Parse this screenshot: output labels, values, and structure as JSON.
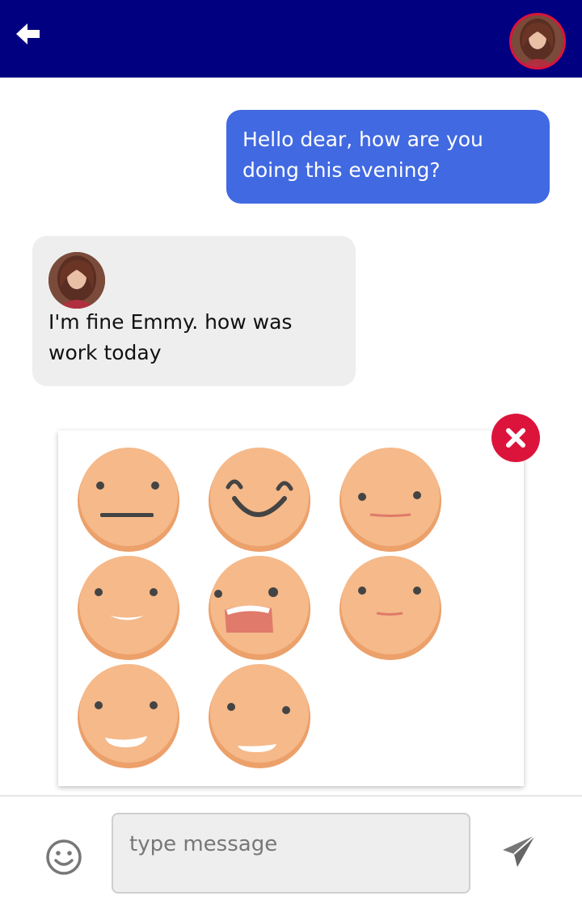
{
  "header": {
    "back_icon": "arrow-left-icon",
    "avatar": "contact-avatar"
  },
  "messages": [
    {
      "direction": "outgoing",
      "text": "Hello dear, how are you doing this evening?"
    },
    {
      "direction": "incoming",
      "text": "I'm fine Emmy. how was work today"
    }
  ],
  "emoji_picker": {
    "emojis": [
      "neutral-face",
      "happy-closed-eyes-face",
      "tight-lips-face",
      "slight-smile-face",
      "shocked-face",
      "small-mouth-face",
      "grin-face",
      "wink-smile-face"
    ],
    "close_icon": "close-x-icon"
  },
  "composer": {
    "emoji_icon": "smiley-icon",
    "placeholder": "type message",
    "value": "",
    "send_icon": "paper-plane-icon"
  },
  "colors": {
    "header": "#000080",
    "outgoing_bubble": "#4169e1",
    "incoming_bubble": "#eeeeee",
    "accent": "#dc143c",
    "emoji_skin": "#f5b98a"
  }
}
